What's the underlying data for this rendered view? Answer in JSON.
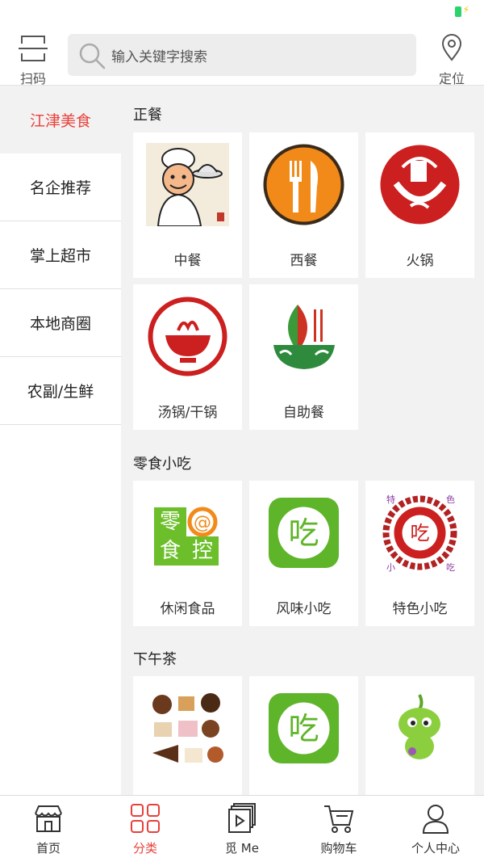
{
  "header": {
    "scan_label": "扫码",
    "search_placeholder": "输入关键字搜索",
    "location_label": "定位"
  },
  "sidebar": {
    "items": [
      {
        "label": "江津美食",
        "active": true
      },
      {
        "label": "名企推荐",
        "active": false
      },
      {
        "label": "掌上超市",
        "active": false
      },
      {
        "label": "本地商圈",
        "active": false
      },
      {
        "label": "农副/生鲜",
        "active": false
      }
    ]
  },
  "sections": [
    {
      "title": "正餐",
      "items": [
        {
          "label": "中餐",
          "icon": "chef-icon"
        },
        {
          "label": "西餐",
          "icon": "fork-knife-icon"
        },
        {
          "label": "火锅",
          "icon": "hotpot-icon"
        },
        {
          "label": "汤锅/干锅",
          "icon": "soup-pot-icon"
        },
        {
          "label": "自助餐",
          "icon": "buffet-icon"
        }
      ]
    },
    {
      "title": "零食小吃",
      "items": [
        {
          "label": "休闲食品",
          "icon": "snack-logo-icon",
          "logo_text": "零@食控"
        },
        {
          "label": "风味小吃",
          "icon": "chi-icon",
          "logo_text": "吃"
        },
        {
          "label": "特色小吃",
          "icon": "special-snack-icon",
          "logo_text": "特色小吃"
        }
      ]
    },
    {
      "title": "下午茶",
      "items": [
        {
          "label": "",
          "icon": "desserts-icon"
        },
        {
          "label": "",
          "icon": "chi-icon",
          "logo_text": "吃"
        },
        {
          "label": "",
          "icon": "mascot-icon"
        }
      ]
    }
  ],
  "tabbar": {
    "tabs": [
      {
        "label": "首页",
        "icon": "store-icon",
        "active": false
      },
      {
        "label": "分类",
        "icon": "category-grid-icon",
        "active": true
      },
      {
        "label": "觅 Me",
        "icon": "video-icon",
        "active": false
      },
      {
        "label": "购物车",
        "icon": "cart-icon",
        "active": false
      },
      {
        "label": "个人中心",
        "icon": "person-icon",
        "active": false
      }
    ]
  },
  "colors": {
    "accent": "#e8403a",
    "green": "#6cbf2a"
  }
}
